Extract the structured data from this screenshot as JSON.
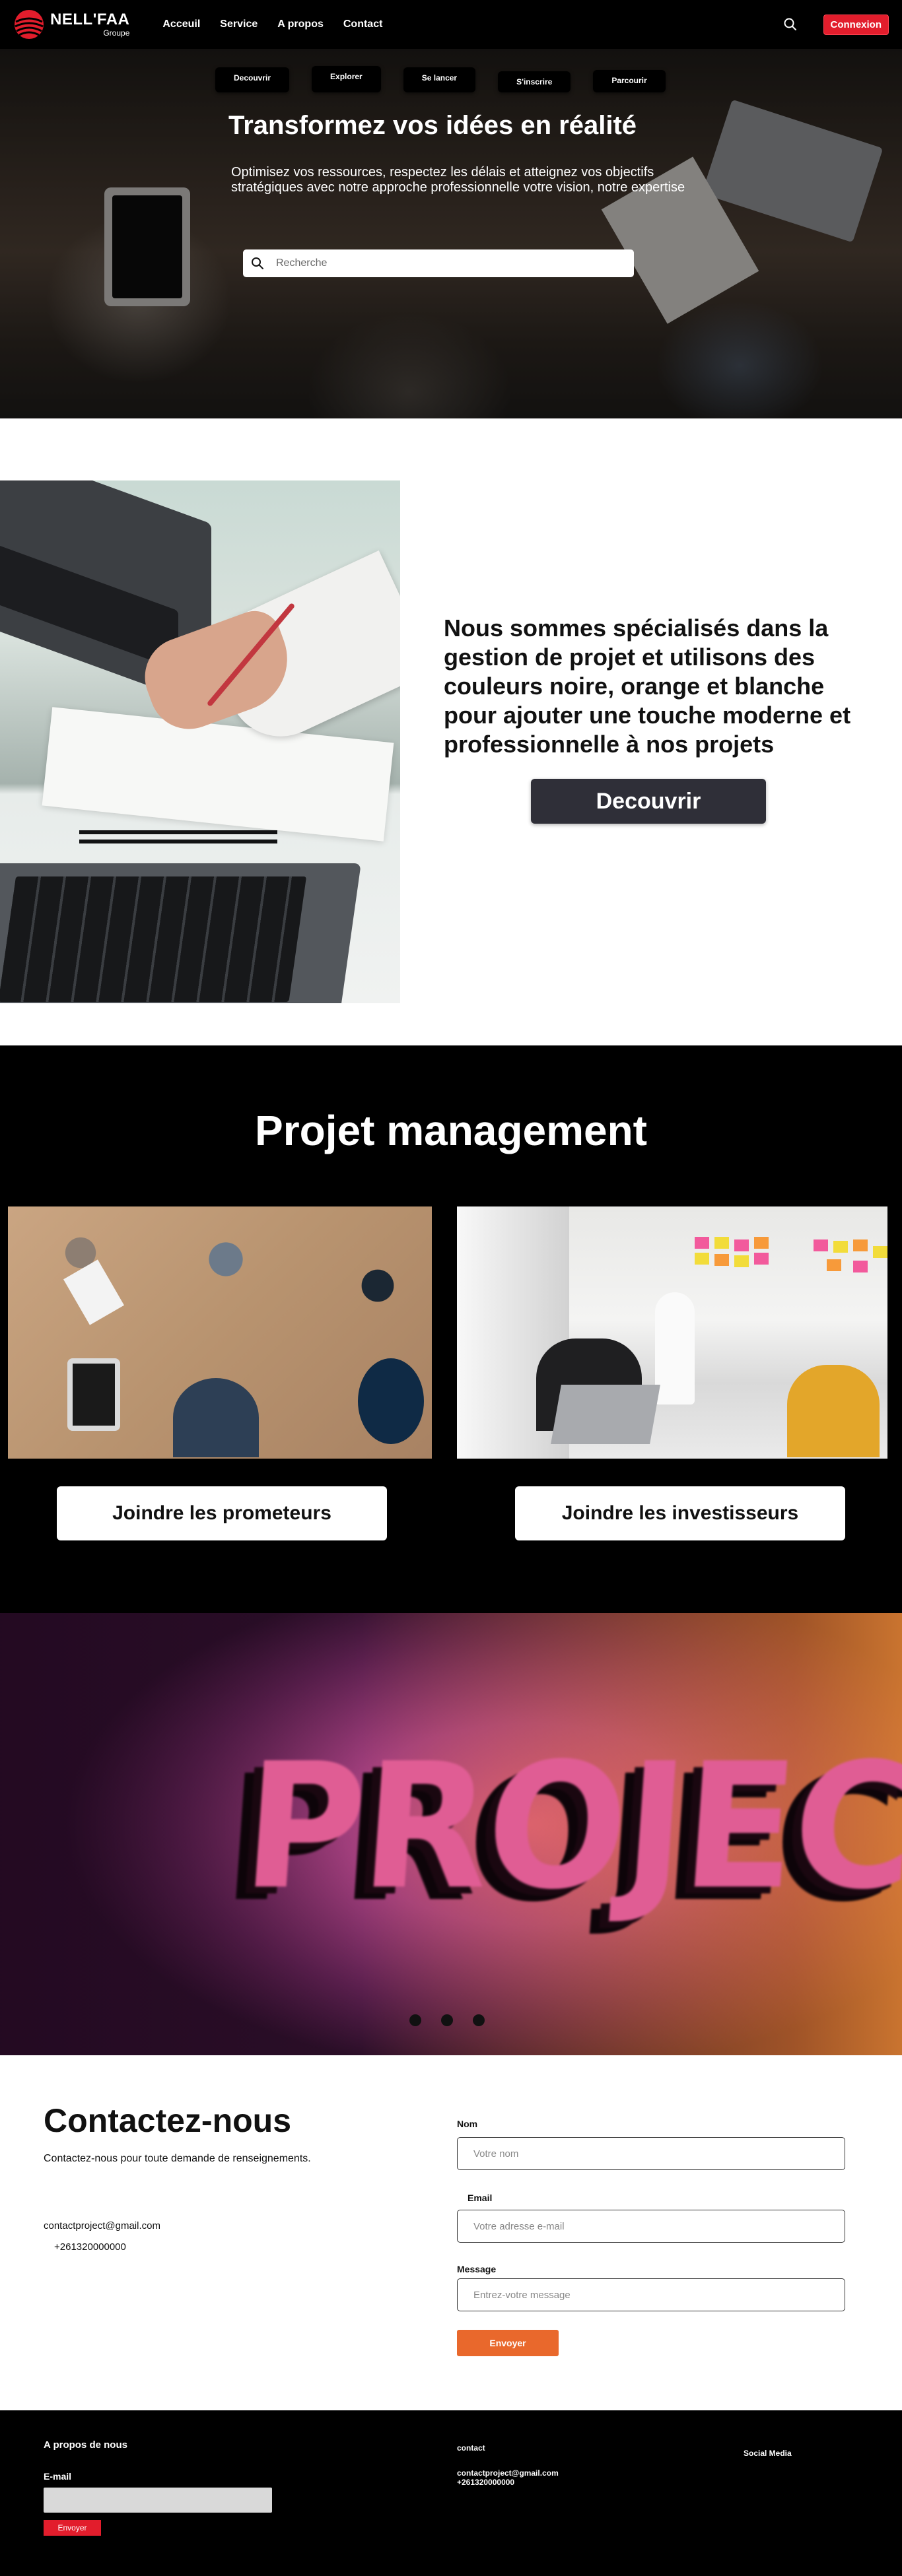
{
  "brand": {
    "name": "NELL'FAA",
    "sub": "Groupe",
    "logo_icon": "brand-logo-icon",
    "accent": "#e21d2c"
  },
  "nav": {
    "links": [
      "Acceuil",
      "Service",
      "A propos",
      "Contact"
    ],
    "search_icon": "search-icon",
    "login_label": "Connexion"
  },
  "hero": {
    "pills": [
      "Decouvrir",
      "Explorer",
      "Se lancer",
      "S'inscrire",
      "Parcourir"
    ],
    "title": "Transformez vos idées en réalité",
    "description": "Optimisez vos ressources, respectez les délais et atteignez vos objectifs stratégiques avec notre approche professionnelle votre vision, notre expertise",
    "search_placeholder": "Recherche"
  },
  "about": {
    "text": "Nous sommes spécialisés dans la gestion de projet et utilisons des couleurs noire, orange et blanche pour ajouter une touche moderne et professionnelle à nos projets",
    "button_label": "Decouvrir",
    "button_color": "#2f2f38"
  },
  "project_management": {
    "title": "Projet management",
    "buttons": [
      "Joindre les prometeurs",
      "Joindre les investisseurs"
    ]
  },
  "banner": {
    "word": "PROJECTS",
    "slides": 3
  },
  "contact": {
    "title": "Contactez-nous",
    "subtitle": "Contactez-nous pour toute demande de renseignements.",
    "email": "contactproject@gmail.com",
    "phone": "+261320000000",
    "form": {
      "name_label": "Nom",
      "name_placeholder": "Votre nom",
      "email_label": "Email",
      "email_placeholder": "Votre adresse e-mail",
      "message_label": "Message",
      "message_placeholder": "Entrez-votre message",
      "send_label": "Envoyer",
      "send_color": "#e9682c"
    }
  },
  "footer": {
    "about_title": "A propos de nous",
    "email_label": "E-mail",
    "send_label": "Envoyer",
    "contact_title": "contact",
    "contact_email": "contactproject@gmail.com",
    "contact_phone": "+261320000000",
    "social_title": "Social Media"
  }
}
